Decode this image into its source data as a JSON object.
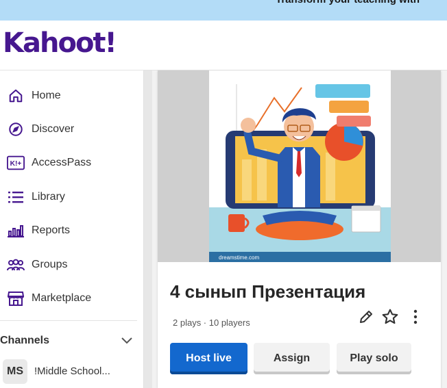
{
  "banner": {
    "text": "Transform your teaching with"
  },
  "header": {
    "logo": "Kahoot!"
  },
  "sidebar": {
    "items": [
      {
        "label": "Home",
        "icon": "home-icon"
      },
      {
        "label": "Discover",
        "icon": "compass-icon"
      },
      {
        "label": "AccessPass",
        "icon": "accesspass-icon"
      },
      {
        "label": "Library",
        "icon": "list-icon"
      },
      {
        "label": "Reports",
        "icon": "bar-chart-icon"
      },
      {
        "label": "Groups",
        "icon": "people-icon"
      },
      {
        "label": "Marketplace",
        "icon": "storefront-icon"
      }
    ],
    "channels_title": "Channels",
    "channel": {
      "initials": "MS",
      "label": "!Middle School..."
    }
  },
  "kahoot": {
    "title": "4 сынып Презентация",
    "meta": "2 plays · 10 players",
    "cover_watermark": "dreamstime.com",
    "accesspass_badge": "K!+",
    "buttons": {
      "host": "Host live",
      "assign": "Assign",
      "solo": "Play solo"
    }
  },
  "colors": {
    "brand": "#46178f",
    "primary": "#1368ce",
    "banner": "#b3dcf7"
  }
}
